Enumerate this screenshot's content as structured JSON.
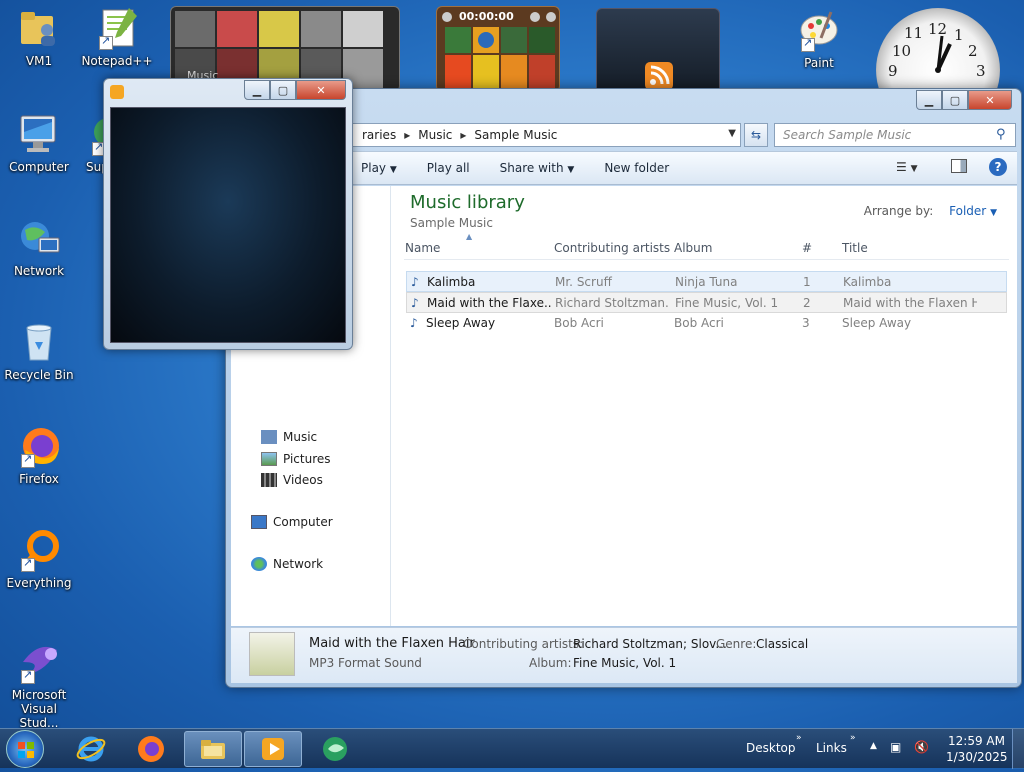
{
  "desktop": {
    "icons": [
      {
        "label": "VM1"
      },
      {
        "label": "Notepad++"
      },
      {
        "label": "Computer"
      },
      {
        "label": "Sup"
      },
      {
        "label": "Network"
      },
      {
        "label": "Recycle Bin"
      },
      {
        "label": "Firefox"
      },
      {
        "label": "Everything"
      },
      {
        "label": "Microsoft Visual Stud..."
      },
      {
        "label": "Paint"
      }
    ]
  },
  "gadgets": {
    "slideshow_label": "Music",
    "media_timer": "00:00:00"
  },
  "clock": {
    "numbers": [
      "12",
      "1",
      "2",
      "3",
      "9",
      "10",
      "11"
    ]
  },
  "explorer": {
    "address": {
      "crumbs": [
        "raries",
        "Music",
        "Sample Music"
      ]
    },
    "search_placeholder": "Search Sample Music",
    "toolbar": {
      "play": "Play",
      "play_all": "Play all",
      "share_with": "Share with",
      "new_folder": "New folder"
    },
    "nav": {
      "music": "Music",
      "pictures": "Pictures",
      "videos": "Videos",
      "computer": "Computer",
      "network": "Network"
    },
    "library_title": "Music library",
    "library_subtitle": "Sample Music",
    "arrange_label": "Arrange by:",
    "arrange_value": "Folder",
    "columns": [
      "Name",
      "Contributing artists",
      "Album",
      "#",
      "Title"
    ],
    "rows": [
      {
        "name": "Kalimba",
        "artist": "Mr. Scruff",
        "album": "Ninja Tuna",
        "num": "1",
        "title": "Kalimba"
      },
      {
        "name": "Maid with the Flaxe...",
        "artist": "Richard Stoltzman...",
        "album": "Fine Music, Vol. 1",
        "num": "2",
        "title": "Maid with the Flaxen H..."
      },
      {
        "name": "Sleep Away",
        "artist": "Bob Acri",
        "album": "Bob Acri",
        "num": "3",
        "title": "Sleep Away"
      }
    ],
    "details": {
      "title": "Maid with the Flaxen Hair",
      "type": "MP3 Format Sound",
      "artists_label": "Contributing artists:",
      "artists_value": "Richard Stoltzman; Slov...",
      "genre_label": "Genre:",
      "genre_value": "Classical",
      "album_label": "Album:",
      "album_value": "Fine Music, Vol. 1"
    }
  },
  "taskbar": {
    "desktop_label": "Desktop",
    "links_label": "Links",
    "time": "12:59 AM",
    "date": "1/30/2025"
  },
  "colors": {
    "accent": "#1e6b2b",
    "link": "#1a5fb4",
    "taskbar": "#1f4170"
  }
}
